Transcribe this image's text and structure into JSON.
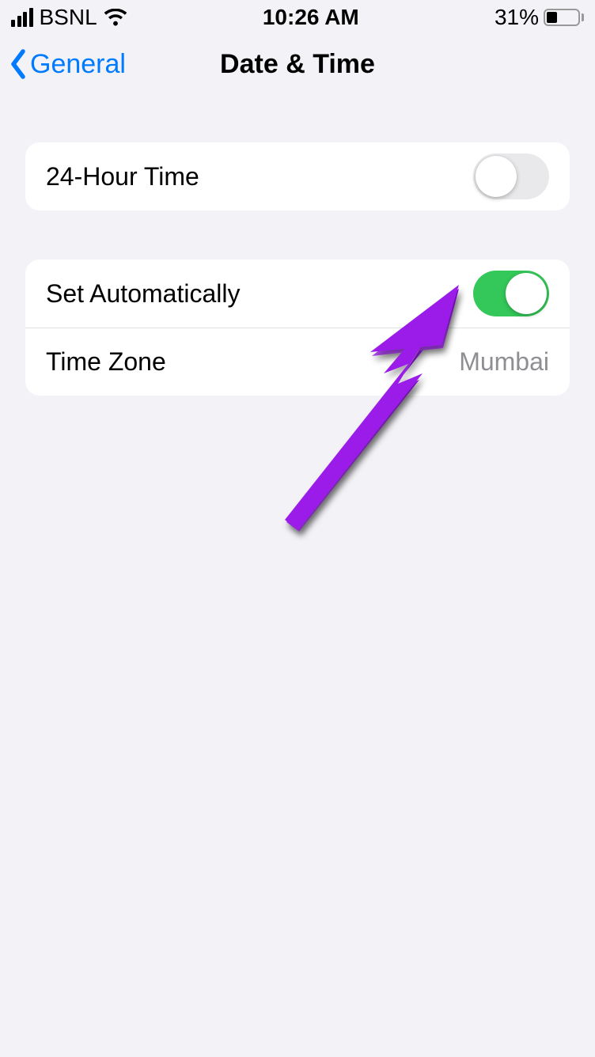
{
  "status": {
    "carrier": "BSNL",
    "time": "10:26 AM",
    "battery_pct": "31%"
  },
  "nav": {
    "back_label": "General",
    "title": "Date & Time"
  },
  "rows": {
    "twenty_four_hour": {
      "label": "24-Hour Time",
      "on": false
    },
    "set_automatically": {
      "label": "Set Automatically",
      "on": true
    },
    "time_zone": {
      "label": "Time Zone",
      "value": "Mumbai"
    }
  },
  "colors": {
    "accent": "#007aff",
    "switch_on": "#34c759",
    "annotation": "#a020f0"
  }
}
